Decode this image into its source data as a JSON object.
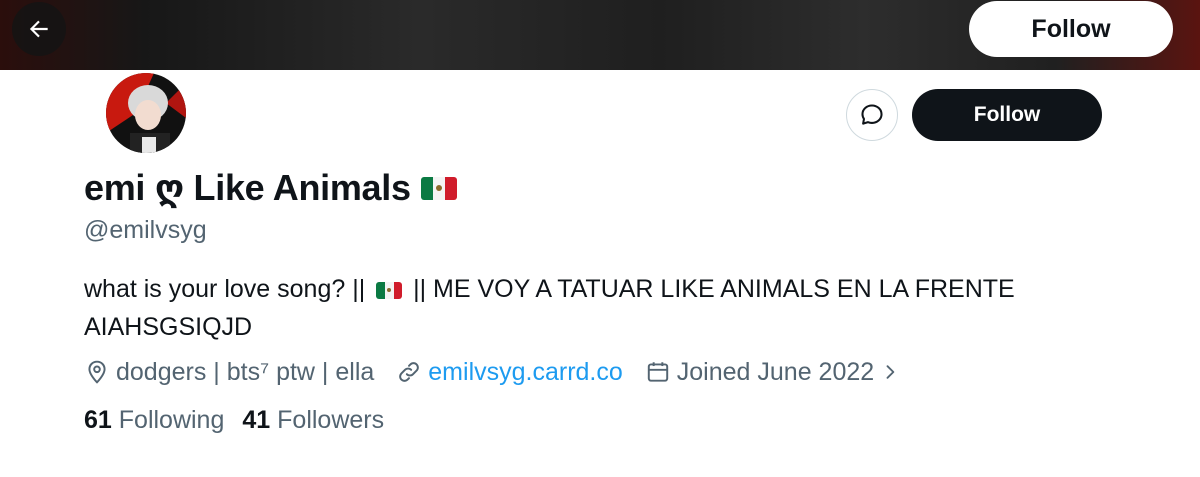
{
  "header": {
    "back_icon": "arrow-left-icon",
    "follow_label": "Follow"
  },
  "profile": {
    "avatar_icon": "avatar",
    "message_icon": "message-icon",
    "follow_label": "Follow",
    "display_name": "emi ღ Like Animals",
    "handle": "@emilvsyg",
    "bio_part1": "what is your love song? ||",
    "bio_part2": "|| ME VOY A TATUAR LIKE ANIMALS EN LA FRENTE AIAHSGSIQJD",
    "location": "dodgers | bts⁷ ptw | ella",
    "website": "emilvsyg.carrd.co",
    "joined": "Joined June 2022",
    "following_count": "61",
    "following_label": "Following",
    "followers_count": "41",
    "followers_label": "Followers"
  },
  "colors": {
    "text_primary": "#0f1419",
    "text_secondary": "#536471",
    "link": "#1d9bf0",
    "button_dark": "#0f1419"
  }
}
